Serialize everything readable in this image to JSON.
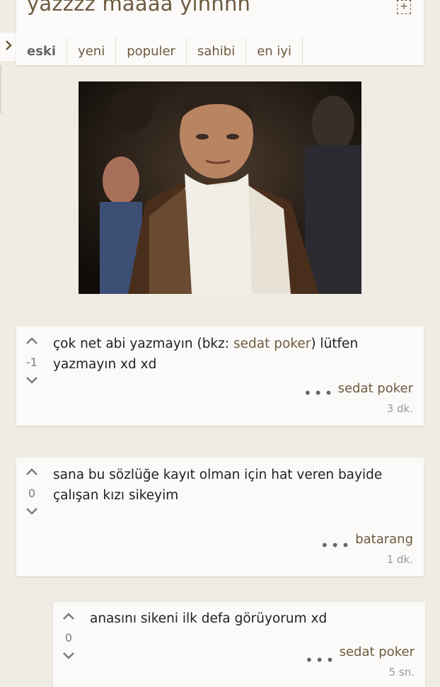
{
  "topic": {
    "title": "yazzzz maaaa yınnnn"
  },
  "tabs": [
    {
      "label": "eski"
    },
    {
      "label": "yeni"
    },
    {
      "label": "populer"
    },
    {
      "label": "sahibi"
    },
    {
      "label": "en iyi"
    }
  ],
  "entries": [
    {
      "text_before": "çok net abi yazmayın  (bkz: ",
      "link": "sedat poker",
      "text_after": ") lütfen yazmayın xd xd",
      "score": "-1",
      "author": "sedat poker",
      "time": "3 dk."
    },
    {
      "text": "sana bu sözlüğe kayıt olman için hat veren bayide çalışan kızı sikeyim",
      "score": "0",
      "author": "batarang",
      "time": "1 dk."
    },
    {
      "text": "anasını sikeni ilk defa görüyorum xd",
      "score": "0",
      "author": "sedat poker",
      "time": "5 sn."
    }
  ],
  "icons": {
    "upvote": "chevron-up-icon",
    "downvote": "chevron-down-icon",
    "more": "more-dots-icon",
    "sidebar": "chevron-right-icon",
    "expand": "plus-box-icon"
  },
  "colors": {
    "accent": "#6d5a3f",
    "background": "#efece4",
    "card": "#fbfaf8"
  }
}
